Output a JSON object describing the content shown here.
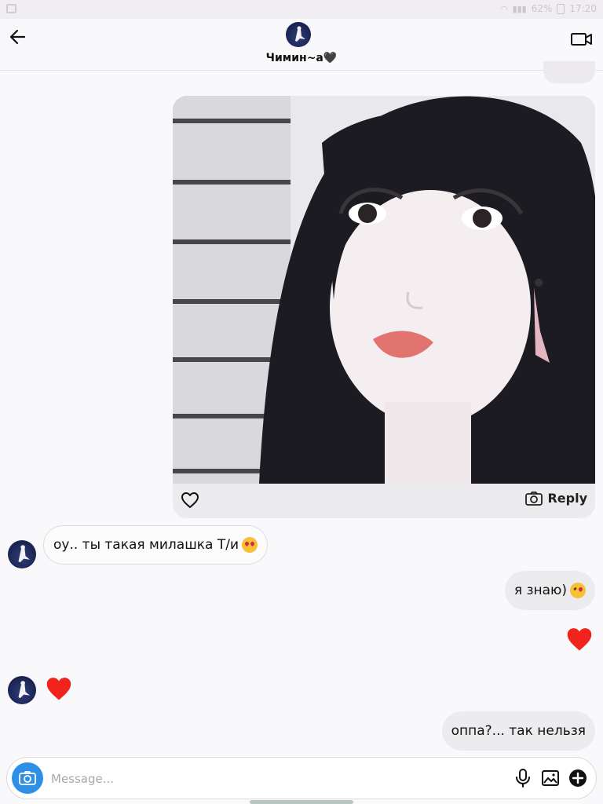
{
  "status_bar": {
    "battery": "62%",
    "time": "17:20"
  },
  "header": {
    "contact_name": "Чимин~а🖤"
  },
  "messages": [
    {
      "sender": "them",
      "text": "оу.. ты такая милашка Т/и"
    },
    {
      "sender": "me",
      "text": "я знаю)"
    },
    {
      "sender": "me",
      "type": "heart"
    },
    {
      "sender": "them",
      "type": "heart"
    },
    {
      "sender": "me",
      "text": "оппа?... так нельзя"
    }
  ],
  "photo_message": {
    "reply_label": "Reply"
  },
  "composer": {
    "placeholder": "Message..."
  },
  "colors": {
    "accent": "#2e8fe6",
    "heart": "#f0241c",
    "bubble_out": "#ececee"
  },
  "icons": [
    "back-arrow-icon",
    "video-call-icon",
    "heart-outline-icon",
    "camera-icon",
    "microphone-icon",
    "gallery-icon",
    "add-icon"
  ]
}
